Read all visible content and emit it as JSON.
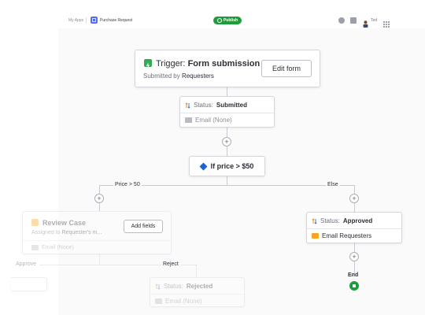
{
  "topbar": {
    "app_crumb": "My Apps",
    "page_crumb": "Purchase Request",
    "publish_label": "Publish",
    "user_name": "Ted"
  },
  "trigger": {
    "prefix": "Trigger:",
    "name": "Form submission",
    "sub_prefix": "Submitted by",
    "sub_value": "Requesters",
    "edit_label": "Edit form"
  },
  "status_submitted": {
    "prefix": "Status:",
    "value": "Submitted",
    "email": "Email (None)"
  },
  "condition": {
    "label": "If price > $50",
    "branch_left": "Price > 50",
    "branch_right": "Else"
  },
  "review_case": {
    "title": "Review Case",
    "sub_prefix": "Assigned to",
    "sub_value": "Requester's m...",
    "add_fields_label": "Add fields",
    "email": "Email (None)"
  },
  "branches": {
    "approve": "Approve",
    "reject": "Reject"
  },
  "status_rejected": {
    "prefix": "Status:",
    "value": "Rejected",
    "email": "Email (None)"
  },
  "status_approved": {
    "prefix": "Status:",
    "value": "Approved",
    "email": "Email Requesters"
  },
  "end": {
    "label": "End"
  },
  "colors": {
    "accent_green": "#1f9d3a",
    "condition_blue": "#1a63d6",
    "review_orange": "#f5a623"
  }
}
